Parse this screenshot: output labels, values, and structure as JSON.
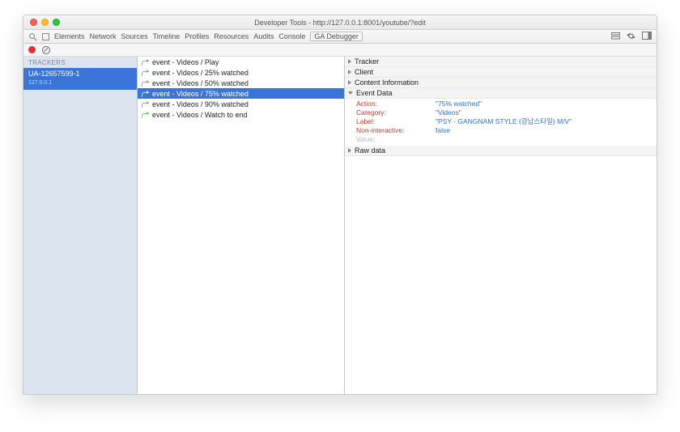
{
  "window": {
    "title": "Developer Tools - http://127.0.0.1:8001/youtube/?edit"
  },
  "tabs": {
    "items": [
      "Elements",
      "Network",
      "Sources",
      "Timeline",
      "Profiles",
      "Resources",
      "Audits",
      "Console",
      "GA Debugger"
    ],
    "active_index": 8
  },
  "sidebar": {
    "heading": "TRACKERS",
    "tracker": {
      "id": "UA-12657599-1",
      "host": "127.0.0.1"
    }
  },
  "events": [
    {
      "label": "event - Videos / Play"
    },
    {
      "label": "event - Videos / 25% watched"
    },
    {
      "label": "event - Videos / 50% watched"
    },
    {
      "label": "event - Videos / 75% watched",
      "selected": true
    },
    {
      "label": "event - Videos / 90% watched"
    },
    {
      "label": "event - Videos / Watch to end"
    }
  ],
  "detail": {
    "sections": {
      "tracker": "Tracker",
      "client": "Client",
      "content": "Content Information",
      "eventdata": "Event Data",
      "rawdata": "Raw data"
    },
    "eventdata": {
      "rows": [
        {
          "k": "Action:",
          "v": "\"75% watched\""
        },
        {
          "k": "Category:",
          "v": "\"Videos\""
        },
        {
          "k": "Label:",
          "v": "\"PSY - GANGNAM STYLE (강남스타일) M/V\""
        },
        {
          "k": "Non-interactive:",
          "v": "false"
        },
        {
          "k": "Value:",
          "v": "",
          "dim": true
        }
      ]
    }
  }
}
